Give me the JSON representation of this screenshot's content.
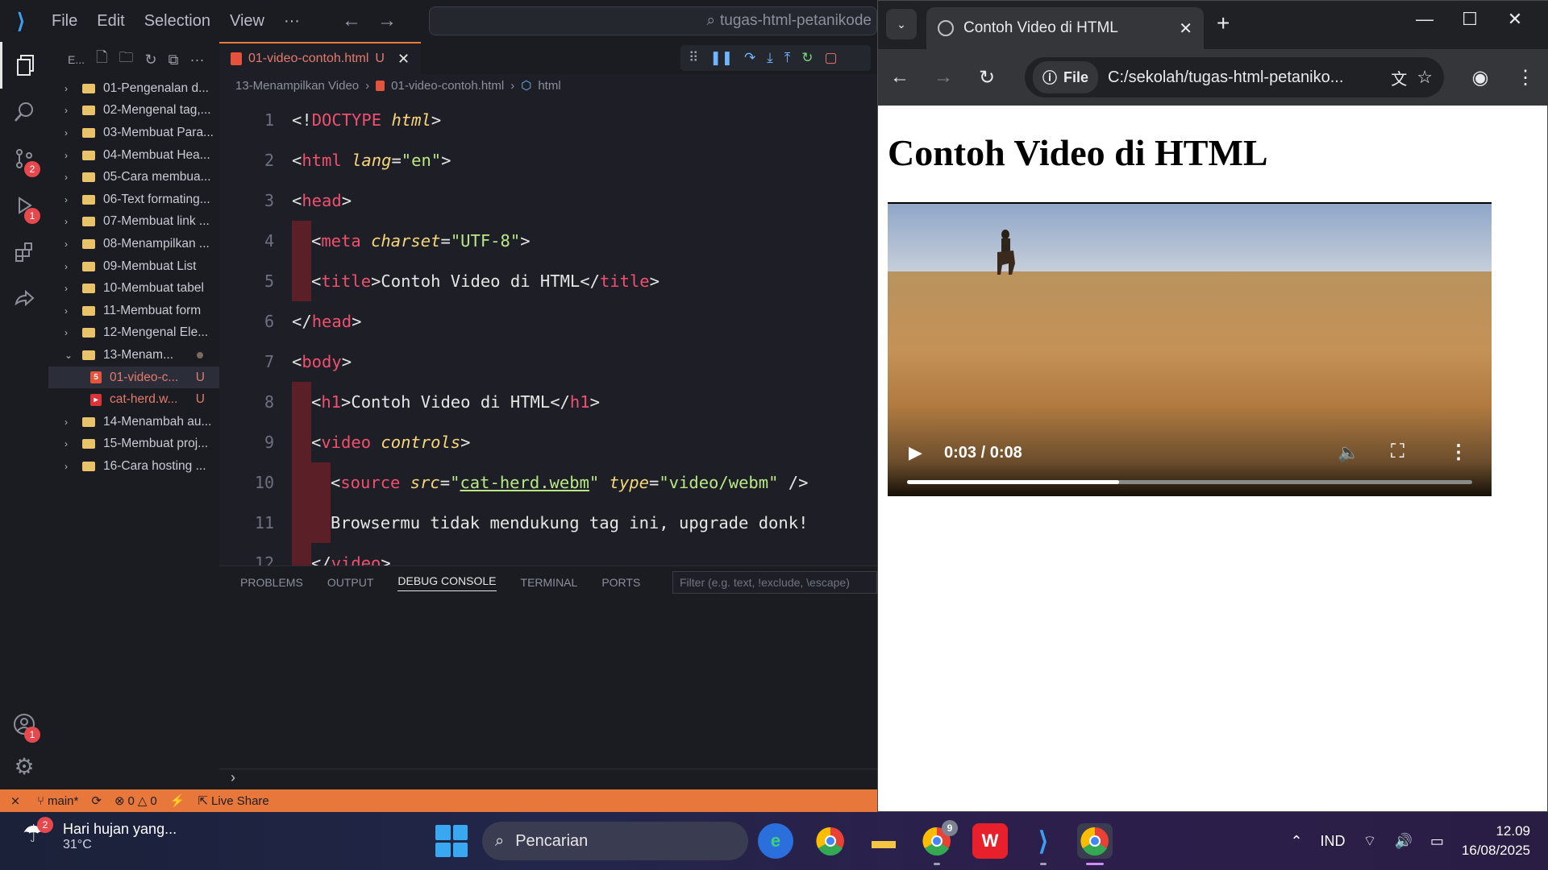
{
  "vscode": {
    "menu": [
      "File",
      "Edit",
      "Selection",
      "View",
      "···"
    ],
    "command_center": "tugas-html-petanikode",
    "sidebar_title": "E...",
    "activity": {
      "scm_badge": "2",
      "debug_badge": "1",
      "account_badge": "1"
    },
    "tree": [
      {
        "label": "01-Pengenalan d...",
        "type": "folder"
      },
      {
        "label": "02-Mengenal tag,...",
        "type": "folder"
      },
      {
        "label": "03-Membuat Para...",
        "type": "folder"
      },
      {
        "label": "04-Membuat Hea...",
        "type": "folder"
      },
      {
        "label": "05-Cara membua...",
        "type": "folder"
      },
      {
        "label": "06-Text formating...",
        "type": "folder"
      },
      {
        "label": "07-Membuat link ...",
        "type": "folder"
      },
      {
        "label": "08-Menampilkan ...",
        "type": "folder"
      },
      {
        "label": "09-Membuat List",
        "type": "folder"
      },
      {
        "label": "10-Membuat tabel",
        "type": "folder"
      },
      {
        "label": "11-Membuat form",
        "type": "folder"
      },
      {
        "label": "12-Mengenal Ele...",
        "type": "folder"
      },
      {
        "label": "13-Menam...",
        "type": "folder-open"
      },
      {
        "label": "01-video-c...",
        "type": "html",
        "status": "U"
      },
      {
        "label": "cat-herd.w...",
        "type": "video",
        "status": "U"
      },
      {
        "label": "14-Menambah au...",
        "type": "folder"
      },
      {
        "label": "15-Membuat proj...",
        "type": "folder"
      },
      {
        "label": "16-Cara hosting ...",
        "type": "folder"
      }
    ],
    "tab": {
      "label": "01-video-contoh.html",
      "status": "U"
    },
    "breadcrumb": [
      "13-Menampilkan Video",
      "01-video-contoh.html",
      "html"
    ],
    "line_numbers": [
      "1",
      "2",
      "3",
      "4",
      "5",
      "6",
      "7",
      "8",
      "9",
      "10",
      "11",
      "12"
    ],
    "panel_tabs": [
      "PROBLEMS",
      "OUTPUT",
      "DEBUG CONSOLE",
      "TERMINAL",
      "PORTS"
    ],
    "panel_filter_placeholder": "Filter (e.g. text, !exclude, \\escape)",
    "status": {
      "branch": "main*",
      "errors": "0",
      "warnings": "0",
      "live_share": "Live Share"
    }
  },
  "chrome": {
    "tab_title": "Contoh Video di HTML",
    "scheme_chip": "File",
    "url": "C:/sekolah/tugas-html-petaniko...",
    "page_heading": "Contoh Video di HTML",
    "video": {
      "time": "0:03 / 0:08",
      "progress": 0.375
    }
  },
  "taskbar": {
    "weather_badge": "2",
    "weather_text": "Hari hujan yang...",
    "temperature": "31°C",
    "search_placeholder": "Pencarian",
    "chrome_badge": "9",
    "language": "IND",
    "time": "12.09",
    "date": "16/08/2025"
  }
}
